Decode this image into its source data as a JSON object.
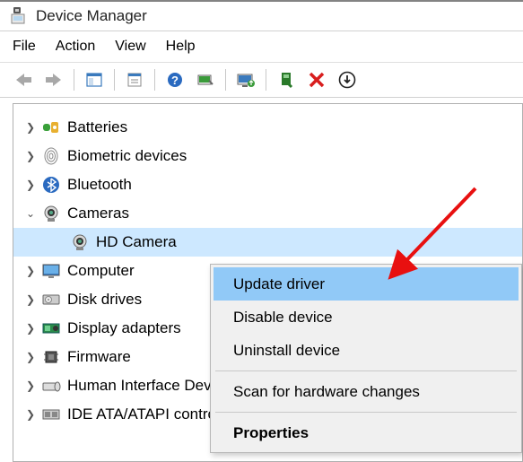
{
  "window": {
    "title": "Device Manager"
  },
  "menu": {
    "file": "File",
    "action": "Action",
    "view": "View",
    "help": "Help"
  },
  "tree": {
    "batteries": "Batteries",
    "biometric": "Biometric devices",
    "bluetooth": "Bluetooth",
    "cameras": "Cameras",
    "hd_camera": "HD Camera",
    "computer": "Computer",
    "disk_drives": "Disk drives",
    "display_adapters": "Display adapters",
    "firmware": "Firmware",
    "hid": "Human Interface Devices",
    "ide": "IDE ATA/ATAPI controllers"
  },
  "context_menu": {
    "update": "Update driver",
    "disable": "Disable device",
    "uninstall": "Uninstall device",
    "scan": "Scan for hardware changes",
    "properties": "Properties"
  }
}
